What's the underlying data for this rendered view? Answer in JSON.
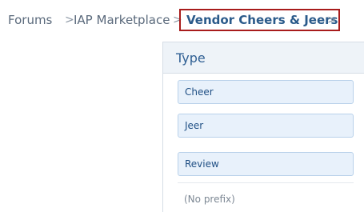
{
  "breadcrumb": {
    "items": [
      {
        "label": "Forums"
      },
      {
        "label": "IAP Marketplace"
      },
      {
        "label": "Vendor Cheers & Jeers"
      }
    ],
    "separator": ">"
  },
  "menu": {
    "title": "Type",
    "options": [
      {
        "label": "Cheer"
      },
      {
        "label": "Jeer"
      },
      {
        "label": "Review"
      }
    ],
    "footer": "(No prefix)"
  },
  "colors": {
    "current_crumb_border": "#a81c1c",
    "menu_header_bg": "#eef3f8",
    "option_bg": "#e8f1fb",
    "option_border": "#b9d1ea",
    "link": "#2a5a8a"
  }
}
